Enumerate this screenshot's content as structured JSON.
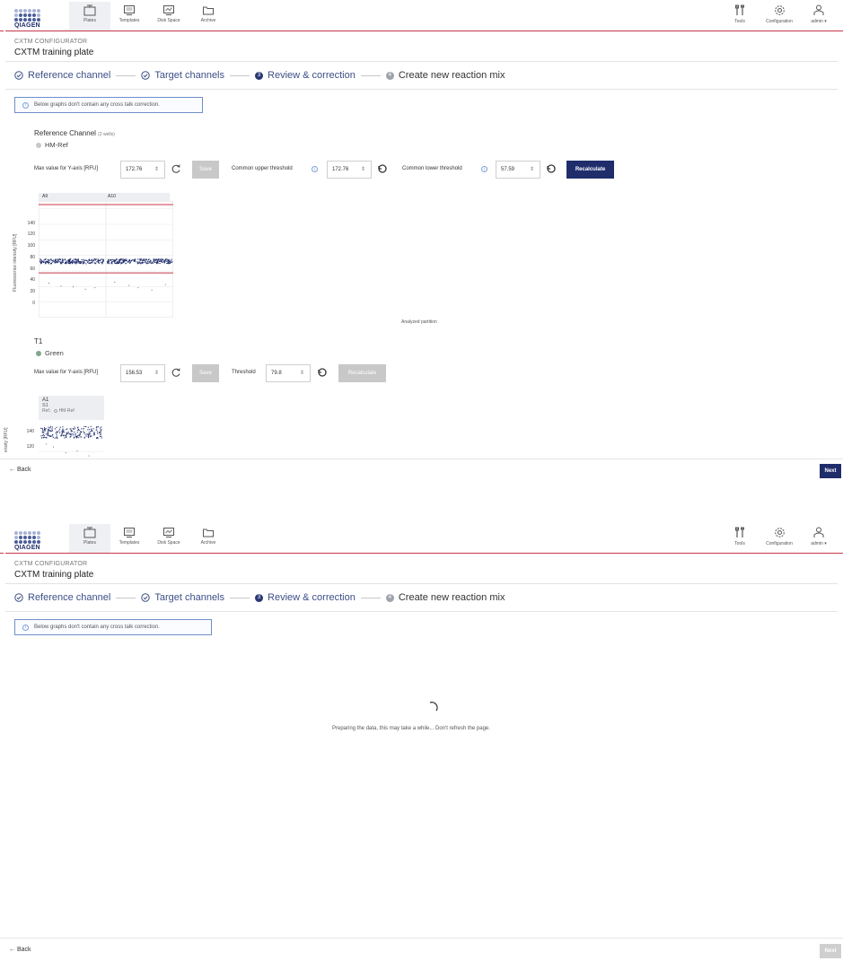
{
  "header": {
    "logo_text": "QIAGEN",
    "nav": [
      {
        "label": "Plates",
        "icon": "plates-icon",
        "active": true
      },
      {
        "label": "Templates",
        "icon": "templates-icon",
        "active": false
      },
      {
        "label": "Disk Space",
        "icon": "disk-space-icon",
        "active": false
      },
      {
        "label": "Archive",
        "icon": "archive-icon",
        "active": false
      }
    ],
    "right_nav": [
      {
        "label": "Tools",
        "icon": "tools-icon"
      },
      {
        "label": "Configuration",
        "icon": "gear-icon"
      },
      {
        "label": "admin ▾",
        "icon": "user-icon"
      }
    ]
  },
  "page": {
    "subtitle": "CXTM CONFIGURATOR",
    "title": "CXTM training plate"
  },
  "stepper": {
    "steps": [
      {
        "label": "Reference channel",
        "state": "done"
      },
      {
        "label": "Target channels",
        "state": "done"
      },
      {
        "label": "Review & correction",
        "state": "current",
        "number": "3"
      },
      {
        "label": "Create new reaction mix",
        "state": "pending",
        "number": "4"
      }
    ]
  },
  "info_message": "Below graphs don't contain any cross talk correction.",
  "reference": {
    "title": "Reference Channel",
    "wells_note": "(2 wells)",
    "channel": "HM-Ref",
    "max_y_label": "Max value for Y-axis [RFU]",
    "max_y_value": "172.76",
    "save_label": "Save",
    "upper_threshold_label": "Common upper threshold",
    "upper_threshold_value": "172.76",
    "lower_threshold_label": "Common lower threshold",
    "lower_threshold_value": "57.59",
    "recalculate_label": "Recalculate"
  },
  "target": {
    "title": "T1",
    "channel": "Green",
    "max_y_label": "Max value for Y-axis [RFU]",
    "max_y_value": "156.53",
    "save_label": "Save",
    "threshold_label": "Threshold",
    "threshold_value": "79.8",
    "recalculate_label": "Recalculate",
    "well": "A1",
    "sample": "S1",
    "ref_label": "Ref.:",
    "ref_channel": "HM-Ref",
    "ytitle_partial": "ensity [RFU]"
  },
  "chart_data": [
    {
      "type": "scatter",
      "title": "",
      "panels": [
        "A9",
        "A10"
      ],
      "ylabel": "Fluorescence intensity [RFU]",
      "xlabel": "Analyzed partition",
      "ylim": [
        0,
        172.76
      ],
      "yticks": [
        0,
        20,
        40,
        60,
        80,
        100,
        120,
        140
      ],
      "upper_threshold": 172.76,
      "lower_threshold": 57.59,
      "clusters": [
        {
          "panel": "A9",
          "positive_band": [
            70,
            76
          ],
          "negative_points": [
            45,
            41,
            40,
            37,
            39
          ]
        },
        {
          "panel": "A10",
          "positive_band": [
            70,
            76
          ],
          "negative_points": [
            46,
            42,
            39,
            36,
            43
          ]
        }
      ],
      "point_color": "#1f2d6b",
      "threshold_color": "#c8374a"
    },
    {
      "type": "scatter",
      "title": "",
      "panels": [
        "A1"
      ],
      "ylabel": "Fluorescence intensity [RFU]",
      "yticks": [
        120,
        140
      ],
      "ylim": [
        115,
        156.53
      ],
      "threshold": 79.8,
      "clusters": [
        {
          "panel": "A1",
          "positive_band": [
            134,
            146
          ],
          "negative_points": [
            128,
            125,
            119,
            121,
            116
          ]
        }
      ],
      "point_color": "#1f2d6b"
    }
  ],
  "footer": {
    "back_label": "← Back",
    "next_label": "Next"
  },
  "loading": {
    "message": "Preparing the data, this may take a while... Don't refresh the page."
  }
}
